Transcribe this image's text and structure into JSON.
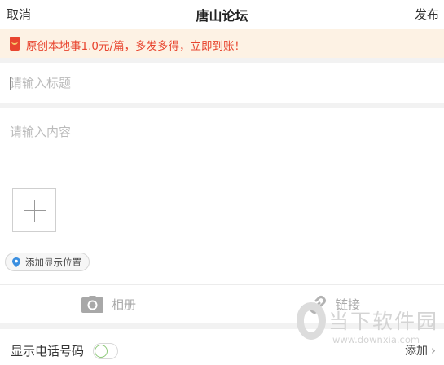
{
  "header": {
    "cancel_label": "取消",
    "title": "唐山论坛",
    "publish_label": "发布"
  },
  "banner": {
    "text": "原创本地事1.0元/篇，多发多得，立即到账！",
    "icon": "red-envelope-icon"
  },
  "form": {
    "title_placeholder": "请输入标题",
    "content_placeholder": "请输入内容"
  },
  "location": {
    "label": "添加显示位置",
    "icon": "location-pin-icon"
  },
  "toolbar": {
    "album_label": "相册",
    "link_label": "链接",
    "album_icon": "camera-icon",
    "link_icon": "link-icon"
  },
  "phone": {
    "label": "显示电话号码",
    "enabled": false,
    "add_label": "添加"
  },
  "watermark": {
    "brand": "当下软件园",
    "url": "www.downxia.com"
  },
  "colors": {
    "accent": "#e8452f",
    "banner_bg": "#fdf2e4",
    "location_pin": "#3a8fe0",
    "toggle_border": "#8ec97a"
  }
}
